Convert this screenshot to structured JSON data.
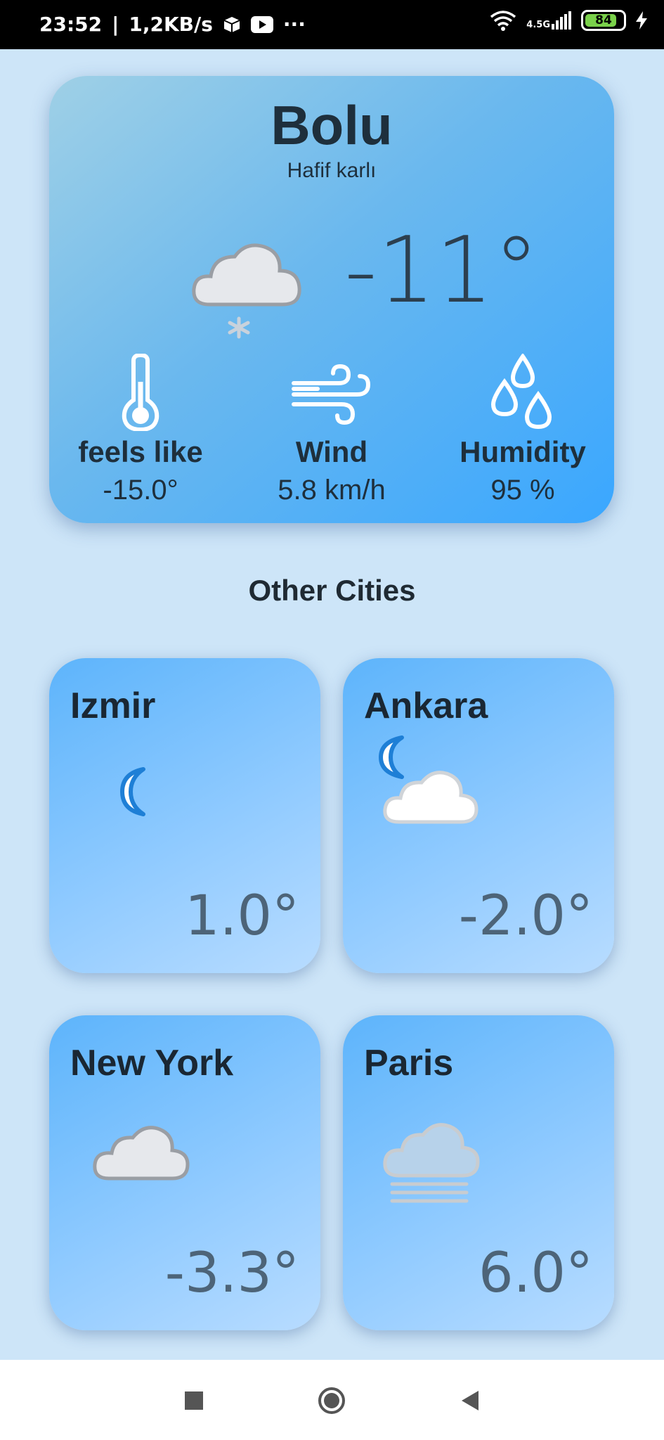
{
  "status_bar": {
    "time": "23:52",
    "net_speed": "1,2KB/s",
    "overflow": "···",
    "network_type": "4.5G",
    "battery": "84"
  },
  "current": {
    "city": "Bolu",
    "description": "Hafif karlı",
    "temperature": "-11°",
    "icon": "snow-cloud-icon",
    "stats": {
      "feels_like": {
        "label": "feels like",
        "value": "-15.0°",
        "icon": "thermometer-icon"
      },
      "wind": {
        "label": "Wind",
        "value": "5.8 km/h",
        "icon": "wind-icon"
      },
      "humidity": {
        "label": "Humidity",
        "value": "95 %",
        "icon": "humidity-drops-icon"
      }
    }
  },
  "other_cities": {
    "title": "Other Cities",
    "cities": [
      {
        "name": "Izmir",
        "temperature": "1.0°",
        "icon": "moon-icon"
      },
      {
        "name": "Ankara",
        "temperature": "-2.0°",
        "icon": "moon-cloud-icon"
      },
      {
        "name": "New York",
        "temperature": "-3.3°",
        "icon": "cloud-icon"
      },
      {
        "name": "Paris",
        "temperature": "6.0°",
        "icon": "fog-icon"
      }
    ]
  },
  "nav_bar": {
    "recents": "square-icon",
    "home": "circle-icon",
    "back": "triangle-back-icon"
  },
  "colors": {
    "background": "#cde5f8",
    "card_blue": "#3aa7ff",
    "moon_blue": "#1e7fd6"
  }
}
